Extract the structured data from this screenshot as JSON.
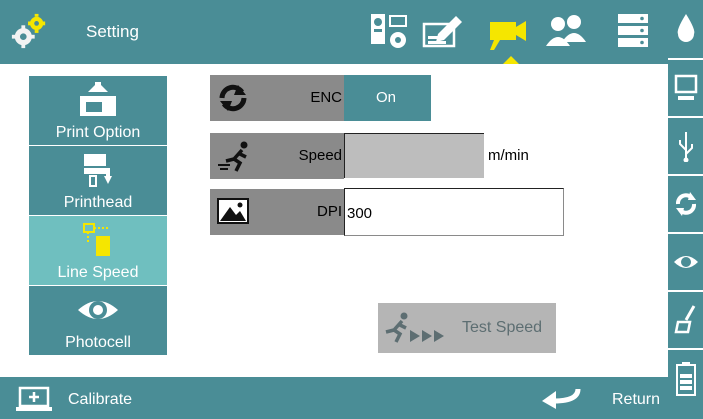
{
  "header": {
    "title": "Setting",
    "tabs": [
      {
        "icon": "printer-settings-icon",
        "active": false
      },
      {
        "icon": "edit-document-icon",
        "active": false
      },
      {
        "icon": "video-camera-icon",
        "active": true
      },
      {
        "icon": "users-icon",
        "active": false
      },
      {
        "icon": "server-icon",
        "active": false
      }
    ]
  },
  "sidebar": {
    "items": [
      {
        "label": "Print Option",
        "icon": "print-option-icon",
        "active": false
      },
      {
        "label": "Printhead",
        "icon": "printhead-icon",
        "active": false
      },
      {
        "label": "Line Speed",
        "icon": "line-speed-icon",
        "active": true
      },
      {
        "label": "Photocell",
        "icon": "photocell-icon",
        "active": false
      }
    ]
  },
  "rightbar": {
    "items": [
      "ink-drop-icon",
      "monitor-icon",
      "usb-icon",
      "refresh-icon",
      "eye-icon",
      "clean-brush-icon",
      "battery-icon"
    ]
  },
  "form": {
    "enc": {
      "label": "ENC",
      "value": "On"
    },
    "speed": {
      "label": "Speed",
      "value": "",
      "unit": "m/min"
    },
    "dpi": {
      "label": "DPI",
      "value": "300"
    }
  },
  "test_button": {
    "label": "Test Speed"
  },
  "footer": {
    "calibrate_label": "Calibrate",
    "return_label": "Return"
  },
  "colors": {
    "bar": "#4a8d96",
    "active_menu": "#6fbfbf",
    "active_tab": "#f5e600",
    "label_bg": "#8a8a8a"
  }
}
